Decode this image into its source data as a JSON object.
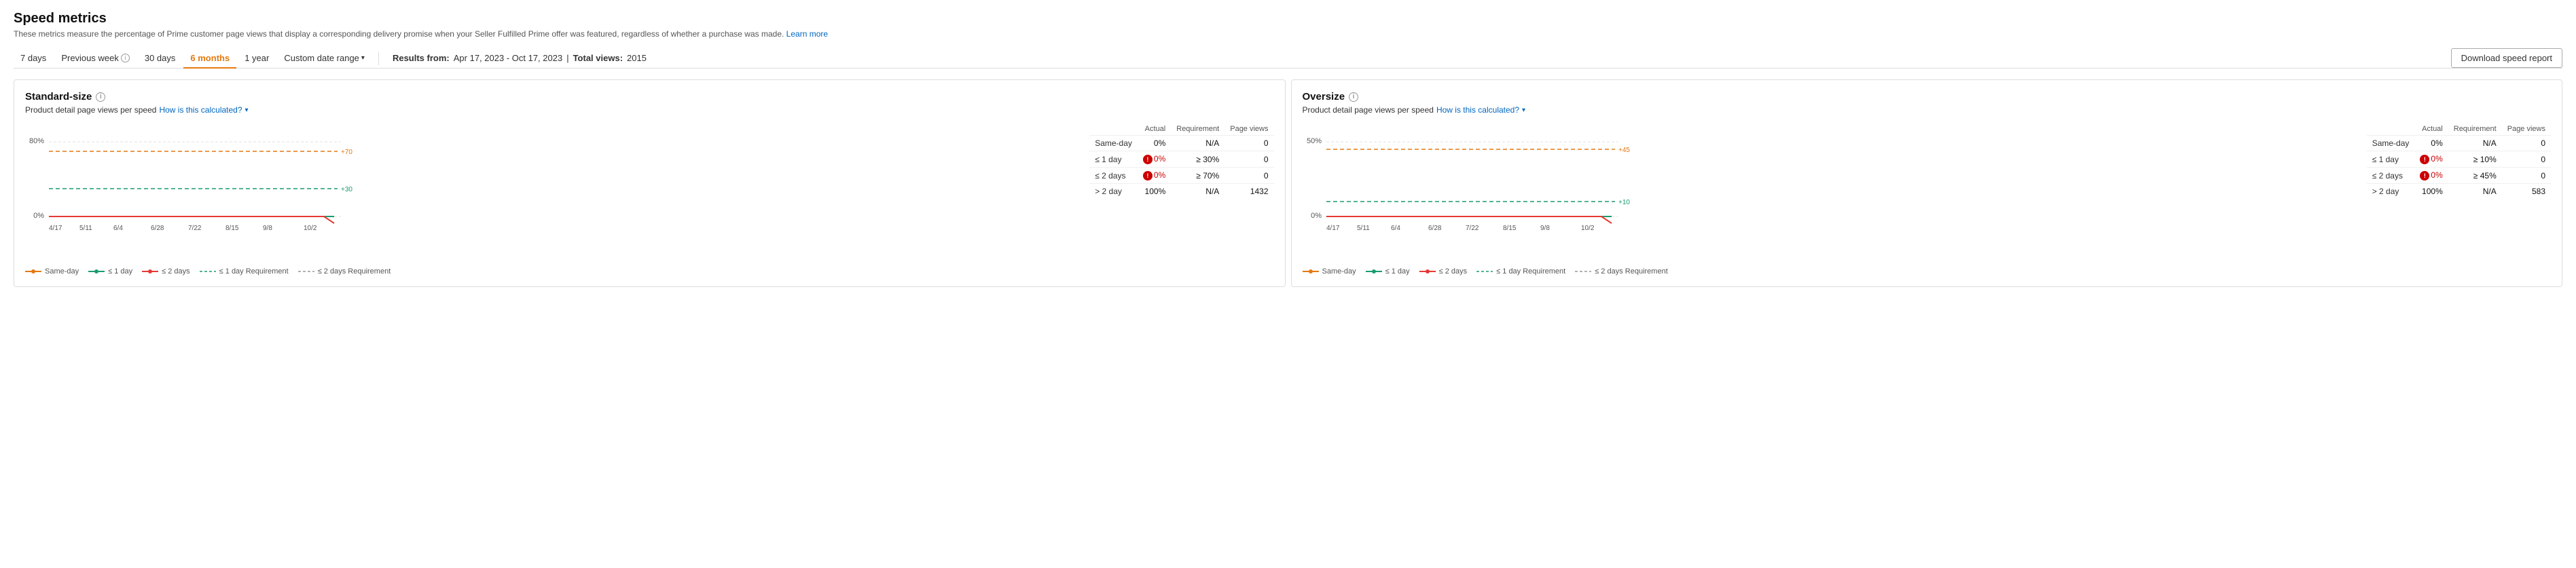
{
  "page": {
    "title": "Speed metrics",
    "subtitle": "These metrics measure the percentage of Prime customer page views that display a corresponding delivery promise when your Seller Fulfilled Prime offer was featured, regardless of whether a purchase was made.",
    "learn_more": "Learn more"
  },
  "toolbar": {
    "buttons": [
      {
        "id": "7days",
        "label": "7 days",
        "active": false
      },
      {
        "id": "prev_week",
        "label": "Previous week",
        "active": false,
        "has_info": true
      },
      {
        "id": "30days",
        "label": "30 days",
        "active": false
      },
      {
        "id": "6months",
        "label": "6 months",
        "active": true
      },
      {
        "id": "1year",
        "label": "1 year",
        "active": false
      },
      {
        "id": "custom",
        "label": "Custom date range",
        "active": false,
        "has_dropdown": true
      }
    ],
    "results_from_label": "Results from:",
    "results_from_value": "Apr 17, 2023 - Oct 17, 2023",
    "total_views_label": "Total views:",
    "total_views_value": "2015",
    "download_label": "Download speed report"
  },
  "standard_size": {
    "title": "Standard-size",
    "subtitle": "Product detail page views per speed",
    "how_calculated": "How is this calculated?",
    "chart": {
      "y_labels": [
        "80%",
        "0%"
      ],
      "x_labels": [
        "4/17",
        "5/11",
        "6/4",
        "6/28",
        "7/22",
        "8/15",
        "9/8",
        "10/2"
      ],
      "ref_labels": [
        "+70",
        "+30"
      ],
      "legend": [
        {
          "label": "Same-day",
          "color": "#e47911",
          "style": "solid"
        },
        {
          "label": "≤ 1 day",
          "color": "#1a9c6e",
          "style": "solid"
        },
        {
          "label": "≤ 2 days",
          "color": "#e53935",
          "style": "solid"
        },
        {
          "label": "≤ 1 day Requirement",
          "color": "#1a9c6e",
          "style": "dashed"
        },
        {
          "label": "≤ 2 days Requirement",
          "color": "#999",
          "style": "dashed"
        }
      ]
    },
    "table": {
      "headers": [
        "",
        "Actual",
        "Requirement",
        "Page views"
      ],
      "rows": [
        {
          "label": "Same-day",
          "actual": "0%",
          "requirement": "N/A",
          "page_views": "0",
          "error": false
        },
        {
          "label": "≤ 1 day",
          "actual": "0%",
          "requirement": "≥ 30%",
          "page_views": "0",
          "error": true
        },
        {
          "label": "≤ 2 days",
          "actual": "0%",
          "requirement": "≥ 70%",
          "page_views": "0",
          "error": true
        },
        {
          "label": "> 2 day",
          "actual": "100%",
          "requirement": "N/A",
          "page_views": "1432",
          "error": false
        }
      ]
    }
  },
  "oversize": {
    "title": "Oversize",
    "subtitle": "Product detail page views per speed",
    "how_calculated": "How is this calculated?",
    "chart": {
      "y_labels": [
        "50%",
        "0%"
      ],
      "x_labels": [
        "4/17",
        "5/11",
        "6/4",
        "6/28",
        "7/22",
        "8/15",
        "9/8",
        "10/2"
      ],
      "ref_labels": [
        "+45",
        "+10"
      ],
      "legend": [
        {
          "label": "Same-day",
          "color": "#e47911",
          "style": "solid"
        },
        {
          "label": "≤ 1 day",
          "color": "#1a9c6e",
          "style": "solid"
        },
        {
          "label": "≤ 2 days",
          "color": "#e53935",
          "style": "solid"
        },
        {
          "label": "≤ 1 day Requirement",
          "color": "#1a9c6e",
          "style": "dashed"
        },
        {
          "label": "≤ 2 days Requirement",
          "color": "#999",
          "style": "dashed"
        }
      ]
    },
    "table": {
      "headers": [
        "",
        "Actual",
        "Requirement",
        "Page views"
      ],
      "rows": [
        {
          "label": "Same-day",
          "actual": "0%",
          "requirement": "N/A",
          "page_views": "0",
          "error": false
        },
        {
          "label": "≤ 1 day",
          "actual": "0%",
          "requirement": "≥ 10%",
          "page_views": "0",
          "error": true
        },
        {
          "label": "≤ 2 days",
          "actual": "0%",
          "requirement": "≥ 45%",
          "page_views": "0",
          "error": true
        },
        {
          "label": "> 2 day",
          "actual": "100%",
          "requirement": "N/A",
          "page_views": "583",
          "error": false
        }
      ]
    }
  }
}
